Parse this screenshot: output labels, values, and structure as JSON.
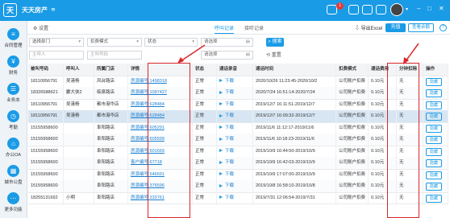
{
  "app": {
    "name": "天天房产",
    "logo_text": "天"
  },
  "topbar": {
    "notification_count": "1",
    "icons": [
      "chat-icon",
      "phone-icon",
      "message-icon",
      "mail-icon"
    ]
  },
  "sidebar": {
    "items": [
      {
        "label": "合同管理",
        "icon": "contract-icon",
        "glyph": "≡"
      },
      {
        "label": "财务",
        "icon": "money-icon",
        "glyph": "¥"
      },
      {
        "label": "业务本",
        "icon": "book-icon",
        "glyph": "☰"
      },
      {
        "label": "考勤",
        "icon": "clock-icon",
        "glyph": "◷"
      },
      {
        "label": "办公OA",
        "icon": "office-icon",
        "glyph": "⌂"
      },
      {
        "label": "城市公盘",
        "icon": "city-icon",
        "glyph": "▦"
      },
      {
        "label": "更多功能",
        "icon": "more-icon",
        "glyph": "⋯"
      }
    ]
  },
  "toolbar": {
    "settings": "设置",
    "tabs": [
      "呼叫记录",
      "接听记录"
    ],
    "active_tab": 0,
    "export": "导出Excel",
    "recharge": "充值",
    "balance": "查看余额",
    "help": "?"
  },
  "filters": {
    "dept": "选择部门",
    "deduct_mode": "扣费模式",
    "status": "状态",
    "caller": "主呼人",
    "called_number": "主叫号码",
    "date_start": "请选择",
    "date_end": "请选择",
    "search": "搜索",
    "reset": "重置"
  },
  "table": {
    "columns": [
      "被叫号码",
      "呼叫人",
      "所属门店",
      "详情",
      "状态",
      "通话录音",
      "通话时间",
      "扣费模式",
      "通话费用",
      "分钟扣除",
      "操作"
    ],
    "download_label": "下载",
    "hide_label": "隐藏",
    "rows": [
      {
        "called": "18110956791",
        "caller": "吴港杨",
        "store": "风台路店",
        "detail": "房源编号:1498318",
        "status": "正常",
        "call_time": "2020/10/26 11:23:45-2020/10/2",
        "mode": "公司账户扣费",
        "fee": "0.10元",
        "minute": "无"
      },
      {
        "called": "18326588621",
        "caller": "麝大侠2",
        "store": "临泉路店",
        "detail": "房源编号:1097427",
        "status": "正常",
        "call_time": "2020/7/24 16:51:14-2020/7/24",
        "mode": "公司账户扣费",
        "fee": "0.10元",
        "minute": "无"
      },
      {
        "called": "18110956791",
        "caller": "吴港杨",
        "store": "都市港华店",
        "detail": "房源编号:628484",
        "status": "正常",
        "call_time": "2019/12/7 16:11:51-2019/12/7",
        "mode": "公司账户扣费",
        "fee": "0.10元",
        "minute": "无"
      },
      {
        "called": "18110956791",
        "caller": "吴港杨",
        "store": "都市港华店",
        "detail": "房源编号:628484",
        "status": "正常",
        "call_time": "2019/12/7 16:09:32-2019/12/7",
        "mode": "公司账户扣费",
        "fee": "0.10元",
        "minute": "无"
      },
      {
        "called": "15155958600",
        "caller": "",
        "store": "阜阳路店",
        "detail": "房源编号:605291",
        "status": "正常",
        "call_time": "2019/11/6 11:12:17-2019/11/6",
        "mode": "公司账户扣费",
        "fee": "0.10元",
        "minute": "无"
      },
      {
        "called": "15155958600",
        "caller": "",
        "store": "阜阳路店",
        "detail": "房源编号:605599",
        "status": "正常",
        "call_time": "2019/11/6 10:18:23-2019/11/6",
        "mode": "公司账户扣费",
        "fee": "0.10元",
        "minute": "无"
      },
      {
        "called": "15155958600",
        "caller": "",
        "store": "阜阳路店",
        "detail": "房源编号:601669",
        "status": "正常",
        "call_time": "2019/10/9 16:44:50-2019/10/9",
        "mode": "公司账户扣费",
        "fee": "0.10元",
        "minute": "无"
      },
      {
        "called": "15155958600",
        "caller": "",
        "store": "阜阳路店",
        "detail": "客户编号:67718",
        "status": "正常",
        "call_time": "2019/10/9 16:42:03-2019/10/9",
        "mode": "公司账户扣费",
        "fee": "0.10元",
        "minute": "无"
      },
      {
        "called": "15155958600",
        "caller": "",
        "store": "阜阳路店",
        "detail": "房源编号:546691",
        "status": "正常",
        "call_time": "2019/10/9 17:07:00-2019/10/9",
        "mode": "公司账户扣费",
        "fee": "0.10元",
        "minute": "无"
      },
      {
        "called": "15155958600",
        "caller": "",
        "store": "阜阳路店",
        "detail": "房源编号:375596",
        "status": "正常",
        "call_time": "2019/10/8 16:58:10-2019/10/8",
        "mode": "公司账户扣费",
        "fee": "0.10元",
        "minute": "无"
      },
      {
        "called": "18255131692",
        "caller": "小明",
        "store": "阜阳路店",
        "detail": "房源编号:333761",
        "status": "正常",
        "call_time": "2019/7/31 12:06:54-2019/7/31",
        "mode": "公司账户扣费",
        "fee": "0.10元",
        "minute": "无"
      }
    ]
  },
  "colors": {
    "primary": "#1a9be6",
    "highlight_row": "#d8e6f3",
    "annotation": "#d9262b"
  }
}
